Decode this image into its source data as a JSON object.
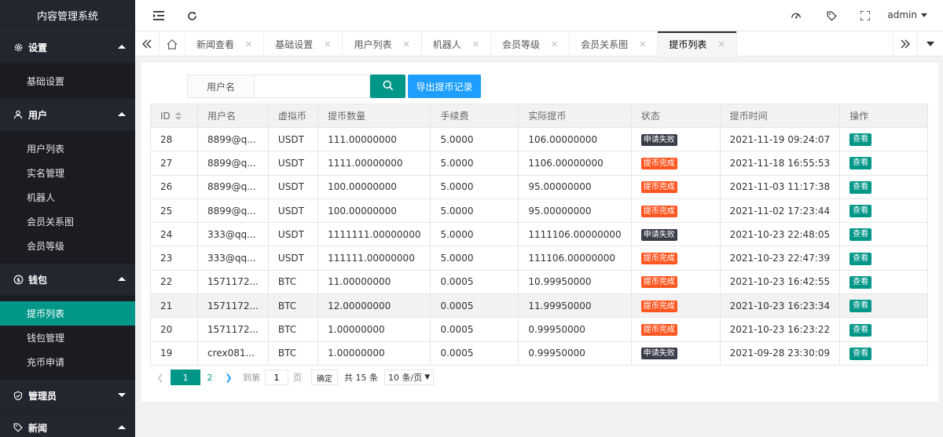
{
  "app": {
    "title": "内容管理系统"
  },
  "sidebar": {
    "groups": [
      {
        "label": "设置",
        "icon": "gear-icon",
        "expanded": true,
        "items": [
          {
            "label": "基础设置"
          }
        ]
      },
      {
        "label": "用户",
        "icon": "user-icon",
        "expanded": true,
        "items": [
          {
            "label": "用户列表"
          },
          {
            "label": "实名管理"
          },
          {
            "label": "机器人"
          },
          {
            "label": "会员关系图"
          },
          {
            "label": "会员等级"
          }
        ]
      },
      {
        "label": "钱包",
        "icon": "dollar-icon",
        "expanded": true,
        "items": [
          {
            "label": "提币列表",
            "active": true
          },
          {
            "label": "钱包管理"
          },
          {
            "label": "充币申请"
          }
        ]
      },
      {
        "label": "管理员",
        "icon": "shield-icon",
        "expanded": false,
        "items": []
      },
      {
        "label": "新闻",
        "icon": "tag-icon",
        "expanded": true,
        "items": []
      }
    ]
  },
  "header": {
    "user": "admin"
  },
  "tabs": [
    {
      "label": "新闻查看"
    },
    {
      "label": "基础设置"
    },
    {
      "label": "用户列表"
    },
    {
      "label": "机器人"
    },
    {
      "label": "会员等级"
    },
    {
      "label": "会员关系图"
    },
    {
      "label": "提币列表",
      "active": true
    }
  ],
  "search": {
    "label": "用户名",
    "value": "",
    "export_label": "导出提币记录"
  },
  "table": {
    "headers": [
      "ID",
      "用户名",
      "虚拟币",
      "提币数量",
      "手续费",
      "实际提币",
      "状态",
      "提币时间",
      "操作"
    ],
    "rows": [
      [
        "28",
        "8899@q...",
        "USDT",
        "111.00000000",
        "5.0000",
        "106.00000000",
        "申请失败",
        "2021-11-19 09:24:07",
        "查看"
      ],
      [
        "27",
        "8899@q...",
        "USDT",
        "1111.00000000",
        "5.0000",
        "1106.00000000",
        "提币完成",
        "2021-11-18 16:55:53",
        "查看"
      ],
      [
        "26",
        "8899@q...",
        "USDT",
        "100.00000000",
        "5.0000",
        "95.00000000",
        "提币完成",
        "2021-11-03 11:17:38",
        "查看"
      ],
      [
        "25",
        "8899@q...",
        "USDT",
        "100.00000000",
        "5.0000",
        "95.00000000",
        "提币完成",
        "2021-11-02 17:23:44",
        "查看"
      ],
      [
        "24",
        "333@qq...",
        "USDT",
        "1111111.00000000",
        "5.0000",
        "1111106.00000000",
        "申请失败",
        "2021-10-23 22:48:05",
        "查看"
      ],
      [
        "23",
        "333@qq...",
        "USDT",
        "111111.00000000",
        "5.0000",
        "111106.00000000",
        "提币完成",
        "2021-10-23 22:47:39",
        "查看"
      ],
      [
        "22",
        "1571172...",
        "BTC",
        "11.00000000",
        "0.0005",
        "10.99950000",
        "提币完成",
        "2021-10-23 16:42:55",
        "查看"
      ],
      [
        "21",
        "1571172...",
        "BTC",
        "12.00000000",
        "0.0005",
        "11.99950000",
        "提币完成",
        "2021-10-23 16:23:34",
        "查看"
      ],
      [
        "20",
        "1571172...",
        "BTC",
        "1.00000000",
        "0.0005",
        "0.99950000",
        "提币完成",
        "2021-10-23 16:23:22",
        "查看"
      ],
      [
        "19",
        "crex081...",
        "BTC",
        "1.00000000",
        "0.0005",
        "0.99950000",
        "申请失败",
        "2021-09-28 23:30:09",
        "查看"
      ]
    ],
    "highlighted_row": 7
  },
  "pager": {
    "current": "1",
    "next_page": "2",
    "goto_prefix": "到第",
    "goto_value": "1",
    "goto_suffix": "页",
    "confirm": "确定",
    "total": "共 15 条",
    "limit": "10 条/页"
  },
  "colors": {
    "accent": "#009688",
    "sidebar": "#23262e",
    "export": "#1e9fff",
    "done": "#ff5722",
    "fail": "#393d49"
  }
}
